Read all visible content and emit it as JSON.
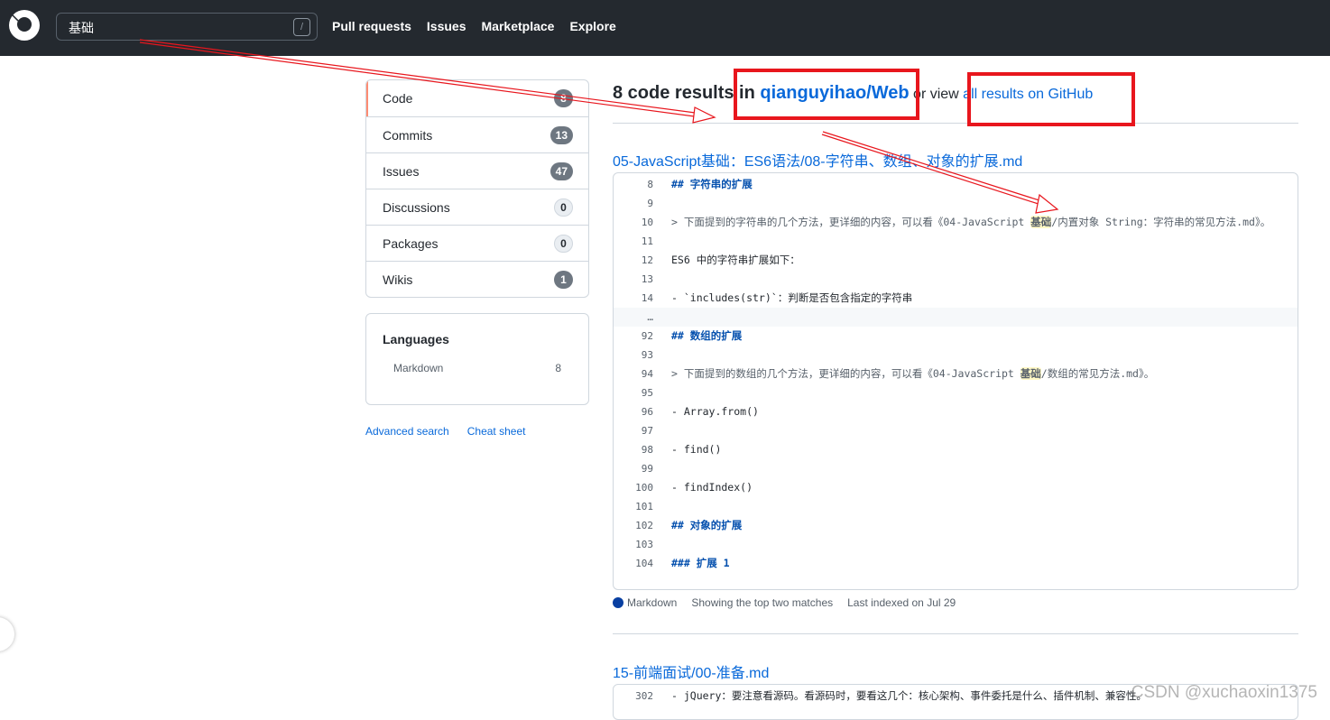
{
  "header": {
    "search_value": "基础",
    "search_shortcut": "/",
    "nav": [
      "Pull requests",
      "Issues",
      "Marketplace",
      "Explore"
    ]
  },
  "sidebar": {
    "items": [
      {
        "label": "Code",
        "count": "8"
      },
      {
        "label": "Commits",
        "count": "13"
      },
      {
        "label": "Issues",
        "count": "47"
      },
      {
        "label": "Discussions",
        "count": "0"
      },
      {
        "label": "Packages",
        "count": "0"
      },
      {
        "label": "Wikis",
        "count": "1"
      }
    ],
    "languages_title": "Languages",
    "languages": [
      {
        "name": "Markdown",
        "count": "8"
      }
    ],
    "advanced_search": "Advanced search",
    "cheat_sheet": "Cheat sheet"
  },
  "main": {
    "results_prefix": "8 code results in ",
    "repo": "qianguyihao/Web",
    "or_view": " or view ",
    "all_results": "all results on GitHub",
    "results": [
      {
        "file": "05-JavaScript基础：ES6语法/08-字符串、数组、对象的扩展.md",
        "lines": [
          {
            "n": "8",
            "k": "h",
            "t": "## 字符串的扩展"
          },
          {
            "n": "9",
            "k": "",
            "t": ""
          },
          {
            "n": "10",
            "k": "q",
            "pre": "> 下面提到的字符串的几个方法，更详细的内容，可以看《04-JavaScript ",
            "hl": "基础",
            "post": "/内置对象 String：字符串的常见方法.md》。"
          },
          {
            "n": "11",
            "k": "",
            "t": ""
          },
          {
            "n": "12",
            "k": "",
            "t": "ES6 中的字符串扩展如下："
          },
          {
            "n": "13",
            "k": "",
            "t": ""
          },
          {
            "n": "14",
            "k": "",
            "t": "-   `includes(str)`：判断是否包含指定的字符串"
          },
          {
            "n": "…",
            "k": "gap",
            "t": ""
          },
          {
            "n": "92",
            "k": "h",
            "t": "## 数组的扩展"
          },
          {
            "n": "93",
            "k": "",
            "t": ""
          },
          {
            "n": "94",
            "k": "q",
            "pre": "> 下面提到的数组的几个方法，更详细的内容，可以看《04-JavaScript ",
            "hl": "基础",
            "post": "/数组的常见方法.md》。"
          },
          {
            "n": "95",
            "k": "",
            "t": ""
          },
          {
            "n": "96",
            "k": "",
            "t": "-   Array.from()"
          },
          {
            "n": "97",
            "k": "",
            "t": ""
          },
          {
            "n": "98",
            "k": "",
            "t": "-   find()"
          },
          {
            "n": "99",
            "k": "",
            "t": ""
          },
          {
            "n": "100",
            "k": "",
            "t": "-   findIndex()"
          },
          {
            "n": "101",
            "k": "",
            "t": ""
          },
          {
            "n": "102",
            "k": "h",
            "t": "## 对象的扩展"
          },
          {
            "n": "103",
            "k": "",
            "t": ""
          },
          {
            "n": "104",
            "k": "h",
            "t": "### 扩展 1"
          }
        ],
        "language": "Markdown",
        "matches": "Showing the top two matches",
        "indexed": "Last indexed on Jul 29"
      },
      {
        "file": "15-前端面试/00-准备.md",
        "lines": [
          {
            "n": "302",
            "k": "",
            "t": "- jQuery：要注意看源码。看源码时，要看这几个：核心架构、事件委托是什么、插件机制、兼容性。"
          }
        ]
      }
    ]
  },
  "watermark": "CSDN @xuchaoxin1375",
  "colors": {
    "header": "#24292f",
    "link": "#0969da",
    "annotation": "#e8161d",
    "markdown": "#083fa1"
  }
}
